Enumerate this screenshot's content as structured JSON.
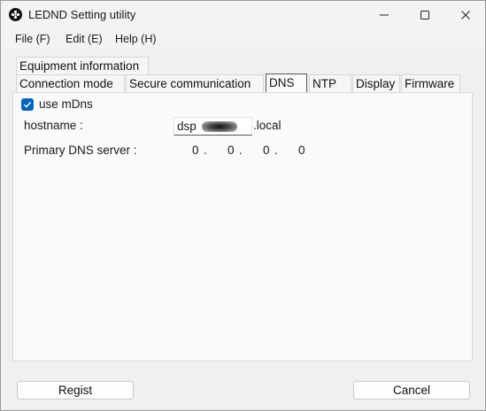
{
  "window": {
    "title": "LEDND Setting utility",
    "icon": "app-logo-icon"
  },
  "menu": [
    {
      "label": "File (F)"
    },
    {
      "label": "Edit (E)"
    },
    {
      "label": "Help (H)"
    }
  ],
  "tabs_row1": [
    {
      "label": "Equipment information"
    }
  ],
  "tabs_row2": [
    {
      "label": "Connection mode"
    },
    {
      "label": "Secure communication"
    },
    {
      "label": "DNS",
      "active": true
    },
    {
      "label": "NTP"
    },
    {
      "label": "Display"
    },
    {
      "label": "Firmware"
    }
  ],
  "dns": {
    "use_mdns_label": "use mDns",
    "use_mdns_checked": true,
    "hostname_label": "hostname :",
    "hostname_value": "dsp",
    "hostname_suffix": ".local",
    "primary_dns_label": "Primary DNS server :",
    "primary_dns_octets": [
      "0",
      "0",
      "0",
      "0"
    ],
    "octet_separator": "."
  },
  "buttons": {
    "regist": "Regist",
    "cancel": "Cancel"
  },
  "colors": {
    "accent": "#0067c0",
    "window_bg": "#f0f0f0",
    "panel_bg": "#fafafa"
  }
}
